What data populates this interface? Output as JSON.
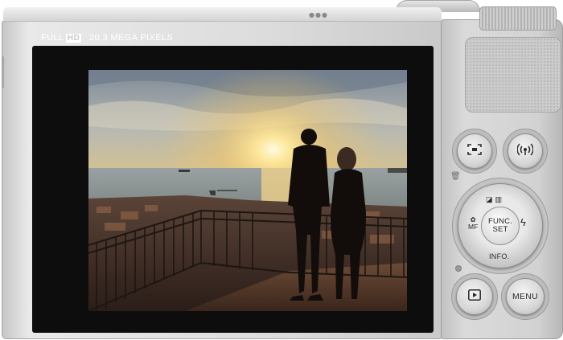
{
  "camera": {
    "video_badge_prefix": "FULL",
    "video_badge_box": "HD",
    "sensor_label": "20.3 MEGA PIXELS"
  },
  "buttons": {
    "frame_assist": {
      "icon": "frame-assist-icon"
    },
    "wifi": {
      "icon": "wifi-icon"
    },
    "func_set_line1": "FUNC.",
    "func_set_line2": "SET",
    "info_label": "INFO.",
    "mf_label": "MF",
    "menu_label": "MENU",
    "playback": {
      "icon": "play-icon"
    },
    "flash": {
      "icon": "flash-icon"
    },
    "macro": {
      "icon": "macro-flower-icon"
    }
  },
  "colors": {
    "body_silver": "#d9d9d9",
    "screen_bezel": "#0d0d0e",
    "sky_top": "#8a96a4",
    "sun": "#fff3b0"
  }
}
